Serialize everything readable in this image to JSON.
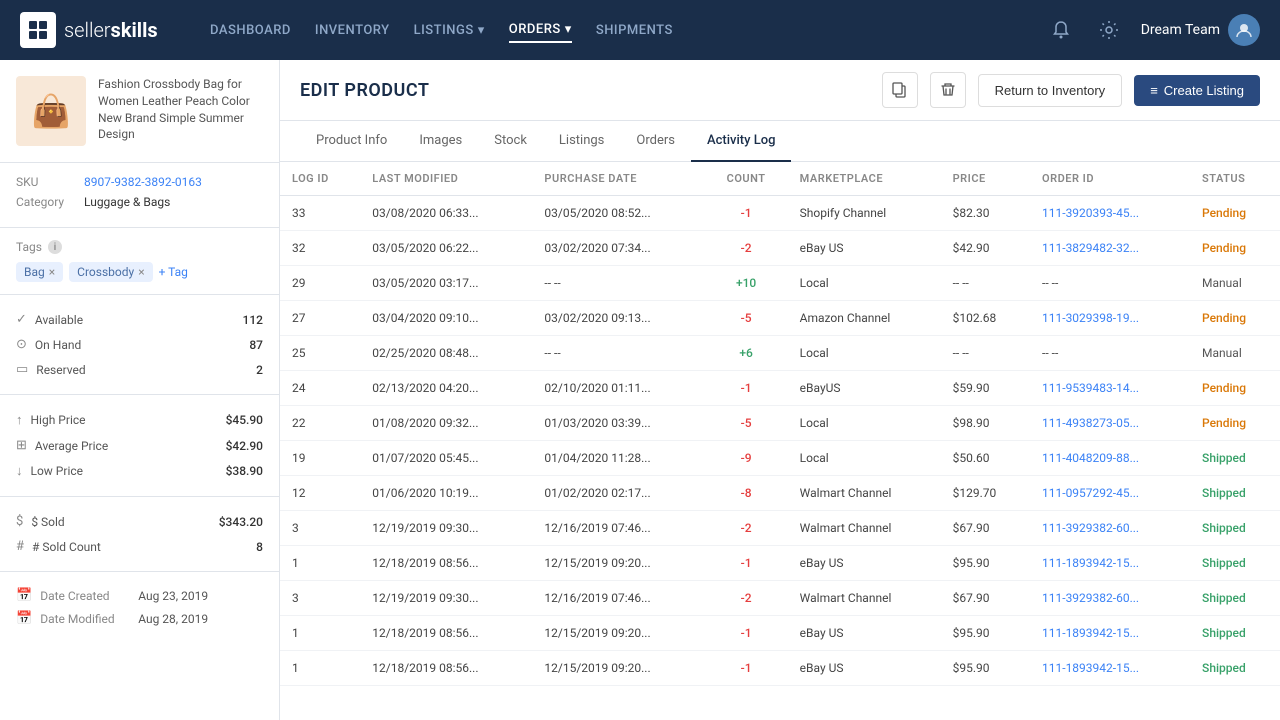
{
  "navbar": {
    "brand": "sellerskills",
    "seller": "seller",
    "skills": "skills",
    "nav_items": [
      {
        "label": "DASHBOARD",
        "active": false
      },
      {
        "label": "INVENTORY",
        "active": false
      },
      {
        "label": "LISTINGS",
        "active": false,
        "dropdown": true
      },
      {
        "label": "ORDERS",
        "active": true,
        "dropdown": true
      },
      {
        "label": "SHIPMENTS",
        "active": false
      }
    ],
    "user": "Dream Team"
  },
  "sidebar": {
    "product_name": "Fashion Crossbody Bag for Women Leather Peach Color New Brand Simple Summer Design",
    "sku_label": "SKU",
    "sku_value": "8907-9382-3892-0163",
    "category_label": "Category",
    "category_value": "Luggage & Bags",
    "tags_label": "Tags",
    "tags": [
      "Bag",
      "Crossbody"
    ],
    "add_tag": "+ Tag",
    "available_label": "Available",
    "available_value": "112",
    "on_hand_label": "On Hand",
    "on_hand_value": "87",
    "reserved_label": "Reserved",
    "reserved_value": "2",
    "high_price_label": "High Price",
    "high_price_value": "$45.90",
    "average_price_label": "Average Price",
    "average_price_value": "$42.90",
    "low_price_label": "Low Price",
    "low_price_value": "$38.90",
    "sold_dollar_label": "$ Sold",
    "sold_dollar_value": "$343.20",
    "sold_count_label": "# Sold Count",
    "sold_count_value": "8",
    "date_created_label": "Date Created",
    "date_created_value": "Aug 23, 2019",
    "date_modified_label": "Date Modified",
    "date_modified_value": "Aug 28, 2019"
  },
  "page": {
    "title": "EDIT PRODUCT",
    "return_label": "Return to Inventory",
    "create_label": "Create Listing"
  },
  "tabs": [
    {
      "label": "Product Info",
      "active": false
    },
    {
      "label": "Images",
      "active": false
    },
    {
      "label": "Stock",
      "active": false
    },
    {
      "label": "Listings",
      "active": false
    },
    {
      "label": "Orders",
      "active": false
    },
    {
      "label": "Activity Log",
      "active": true
    }
  ],
  "table": {
    "columns": [
      "LOG ID",
      "LAST MODIFIED",
      "PURCHASE DATE",
      "COUNT",
      "MARKETPLACE",
      "PRICE",
      "ORDER ID",
      "STATUS"
    ],
    "rows": [
      {
        "log_id": "33",
        "last_modified": "03/08/2020 06:33...",
        "purchase_date": "03/05/2020 08:52...",
        "count": "-1",
        "count_type": "neg",
        "marketplace": "Shopify Channel",
        "price": "$82.30",
        "order_id": "111-3920393-45...",
        "status": "Pending",
        "status_type": "pending"
      },
      {
        "log_id": "32",
        "last_modified": "03/05/2020 06:22...",
        "purchase_date": "03/02/2020 07:34...",
        "count": "-2",
        "count_type": "neg",
        "marketplace": "eBay US",
        "price": "$42.90",
        "order_id": "111-3829482-32...",
        "status": "Pending",
        "status_type": "pending"
      },
      {
        "log_id": "29",
        "last_modified": "03/05/2020 03:17...",
        "purchase_date": "-- --",
        "count": "+10",
        "count_type": "pos",
        "marketplace": "Local",
        "price": "-- --",
        "order_id": "-- --",
        "status": "Manual",
        "status_type": "manual"
      },
      {
        "log_id": "27",
        "last_modified": "03/04/2020 09:10...",
        "purchase_date": "03/02/2020 09:13...",
        "count": "-5",
        "count_type": "neg",
        "marketplace": "Amazon Channel",
        "price": "$102.68",
        "order_id": "111-3029398-19...",
        "status": "Pending",
        "status_type": "pending"
      },
      {
        "log_id": "25",
        "last_modified": "02/25/2020 08:48...",
        "purchase_date": "-- --",
        "count": "+6",
        "count_type": "pos",
        "marketplace": "Local",
        "price": "-- --",
        "order_id": "-- --",
        "status": "Manual",
        "status_type": "manual"
      },
      {
        "log_id": "24",
        "last_modified": "02/13/2020 04:20...",
        "purchase_date": "02/10/2020 01:11...",
        "count": "-1",
        "count_type": "neg",
        "marketplace": "eBayUS",
        "price": "$59.90",
        "order_id": "111-9539483-14...",
        "status": "Pending",
        "status_type": "pending"
      },
      {
        "log_id": "22",
        "last_modified": "01/08/2020 09:32...",
        "purchase_date": "01/03/2020 03:39...",
        "count": "-5",
        "count_type": "neg",
        "marketplace": "Local",
        "price": "$98.90",
        "order_id": "111-4938273-05...",
        "status": "Pending",
        "status_type": "pending"
      },
      {
        "log_id": "19",
        "last_modified": "01/07/2020 05:45...",
        "purchase_date": "01/04/2020 11:28...",
        "count": "-9",
        "count_type": "neg",
        "marketplace": "Local",
        "price": "$50.60",
        "order_id": "111-4048209-88...",
        "status": "Shipped",
        "status_type": "shipped"
      },
      {
        "log_id": "12",
        "last_modified": "01/06/2020 10:19...",
        "purchase_date": "01/02/2020 02:17...",
        "count": "-8",
        "count_type": "neg",
        "marketplace": "Walmart Channel",
        "price": "$129.70",
        "order_id": "111-0957292-45...",
        "status": "Shipped",
        "status_type": "shipped"
      },
      {
        "log_id": "3",
        "last_modified": "12/19/2019 09:30...",
        "purchase_date": "12/16/2019 07:46...",
        "count": "-2",
        "count_type": "neg",
        "marketplace": "Walmart Channel",
        "price": "$67.90",
        "order_id": "111-3929382-60...",
        "status": "Shipped",
        "status_type": "shipped"
      },
      {
        "log_id": "1",
        "last_modified": "12/18/2019 08:56...",
        "purchase_date": "12/15/2019 09:20...",
        "count": "-1",
        "count_type": "neg",
        "marketplace": "eBay US",
        "price": "$95.90",
        "order_id": "111-1893942-15...",
        "status": "Shipped",
        "status_type": "shipped"
      },
      {
        "log_id": "3",
        "last_modified": "12/19/2019 09:30...",
        "purchase_date": "12/16/2019 07:46...",
        "count": "-2",
        "count_type": "neg",
        "marketplace": "Walmart Channel",
        "price": "$67.90",
        "order_id": "111-3929382-60...",
        "status": "Shipped",
        "status_type": "shipped"
      },
      {
        "log_id": "1",
        "last_modified": "12/18/2019 08:56...",
        "purchase_date": "12/15/2019 09:20...",
        "count": "-1",
        "count_type": "neg",
        "marketplace": "eBay US",
        "price": "$95.90",
        "order_id": "111-1893942-15...",
        "status": "Shipped",
        "status_type": "shipped"
      },
      {
        "log_id": "1",
        "last_modified": "12/18/2019 08:56...",
        "purchase_date": "12/15/2019 09:20...",
        "count": "-1",
        "count_type": "neg",
        "marketplace": "eBay US",
        "price": "$95.90",
        "order_id": "111-1893942-15...",
        "status": "Shipped",
        "status_type": "shipped"
      }
    ]
  }
}
